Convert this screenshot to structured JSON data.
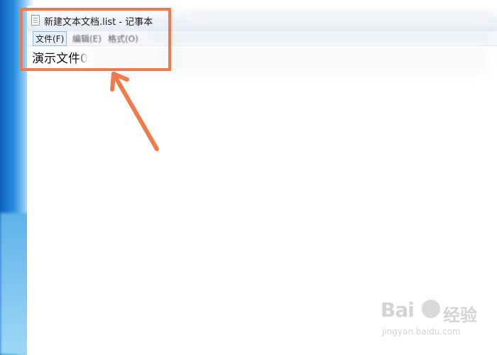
{
  "window": {
    "title": "新建文本文档.list - 记事本",
    "app_icon": "notepad-icon"
  },
  "menubar": {
    "items": [
      {
        "label": "文件(F)"
      },
      {
        "label": "编辑(E)"
      },
      {
        "label": "格式(O)"
      }
    ]
  },
  "editor": {
    "content": "演示文件0"
  },
  "annotation": {
    "color": "#f07a4a"
  },
  "watermark": {
    "brand": "Bai",
    "brand_cn": "经验",
    "url": "jingyan.baidu.com",
    "color": "#d4d4d4"
  }
}
